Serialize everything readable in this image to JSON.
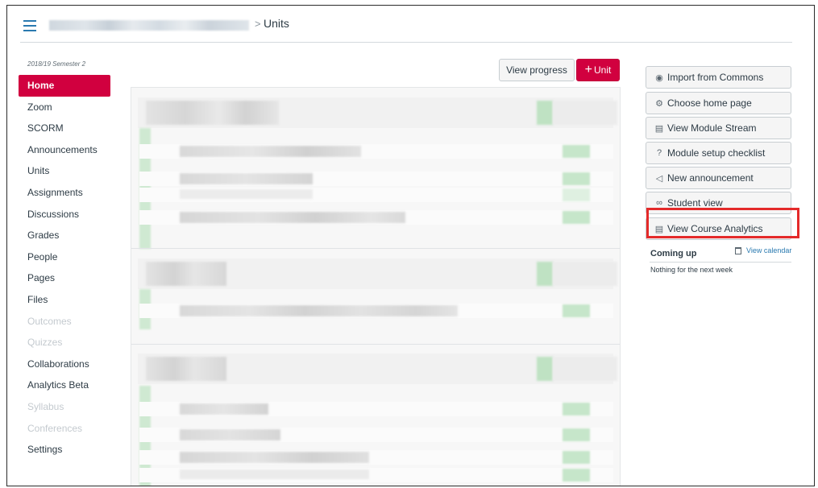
{
  "header": {
    "current_page": "Units",
    "separator": ">"
  },
  "term": "2018/19 Semester 2",
  "nav": {
    "items": [
      {
        "label": "Home",
        "state": "active"
      },
      {
        "label": "Zoom",
        "state": "normal"
      },
      {
        "label": "SCORM",
        "state": "normal"
      },
      {
        "label": "Announcements",
        "state": "normal"
      },
      {
        "label": "Units",
        "state": "normal"
      },
      {
        "label": "Assignments",
        "state": "normal"
      },
      {
        "label": "Discussions",
        "state": "normal"
      },
      {
        "label": "Grades",
        "state": "normal"
      },
      {
        "label": "People",
        "state": "normal"
      },
      {
        "label": "Pages",
        "state": "normal"
      },
      {
        "label": "Files",
        "state": "normal"
      },
      {
        "label": "Outcomes",
        "state": "disabled"
      },
      {
        "label": "Quizzes",
        "state": "disabled"
      },
      {
        "label": "Collaborations",
        "state": "normal"
      },
      {
        "label": "Analytics Beta",
        "state": "normal"
      },
      {
        "label": "Syllabus",
        "state": "disabled"
      },
      {
        "label": "Conferences",
        "state": "disabled"
      },
      {
        "label": "Settings",
        "state": "normal"
      }
    ]
  },
  "toolbar": {
    "view_progress_label": "View progress",
    "add_unit_plus": "+",
    "add_unit_label": "Unit"
  },
  "sidebar": {
    "buttons": [
      {
        "label": "Import from Commons",
        "icon": "commons-icon",
        "glyph": "◉"
      },
      {
        "label": "Choose home page",
        "icon": "home-page-icon",
        "glyph": "⚙"
      },
      {
        "label": "View Module Stream",
        "icon": "stream-icon",
        "glyph": "▤"
      },
      {
        "label": "Module setup checklist",
        "icon": "help-circle-icon",
        "glyph": "?"
      },
      {
        "label": "New announcement",
        "icon": "megaphone-icon",
        "glyph": "◁"
      },
      {
        "label": "Student view",
        "icon": "glasses-icon",
        "glyph": "∞"
      },
      {
        "label": "View Course Analytics",
        "icon": "analytics-icon",
        "glyph": "▤"
      }
    ],
    "coming_up": {
      "title": "Coming up",
      "view_calendar": "View calendar",
      "empty": "Nothing for the next week"
    }
  },
  "colors": {
    "accent": "#d1003f",
    "link": "#2a7ab0",
    "highlight": "#e42a2a"
  }
}
